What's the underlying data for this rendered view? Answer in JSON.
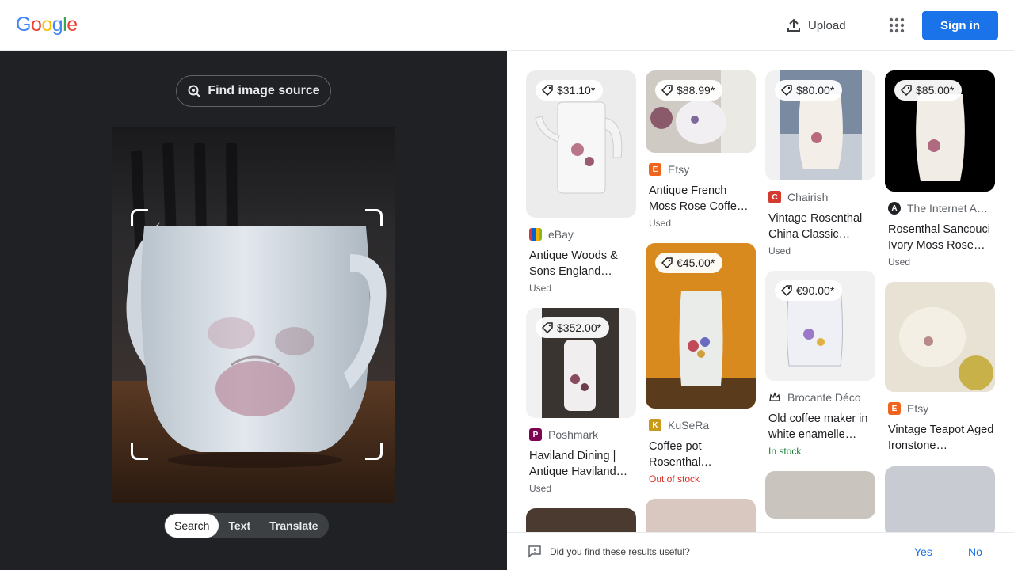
{
  "header": {
    "logo": [
      "G",
      "o",
      "o",
      "g",
      "l",
      "e"
    ],
    "logo_colors": [
      "#4285F4",
      "#EA4335",
      "#FBBC05",
      "#4285F4",
      "#34A853",
      "#EA4335"
    ],
    "upload_label": "Upload",
    "signin_label": "Sign in"
  },
  "left": {
    "find_source_label": "Find image source",
    "modes": [
      "Search",
      "Text",
      "Translate"
    ],
    "active_mode": "Search"
  },
  "results": {
    "col1": [
      {
        "price": "$31.10*",
        "source": "eBay",
        "title": "Antique Woods & Sons England…",
        "status": "Used"
      },
      {
        "price": "$352.00*",
        "source": "Poshmark",
        "title": "Haviland Dining | Antique Haviland…",
        "status": "Used"
      }
    ],
    "col2": [
      {
        "price": "$88.99*",
        "source": "Etsy",
        "title": "Antique French Moss Rose Coffe…",
        "status": "Used"
      },
      {
        "price": "€45.00*",
        "source": "KuSeRa",
        "title": "Coffee pot Rosenthal…",
        "status": "Out of stock"
      }
    ],
    "col3": [
      {
        "price": "$80.00*",
        "source": "Chairish",
        "title": "Vintage Rosenthal China Classic…",
        "status": "Used"
      },
      {
        "price": "€90.00*",
        "source": "Brocante Déco",
        "title": "Old coffee maker in white enamelle…",
        "status": "In stock"
      }
    ],
    "col4": [
      {
        "price": "$85.00*",
        "source": "The Internet A…",
        "title": "Rosenthal Sancouci Ivory Moss Rose…",
        "status": "Used"
      },
      {
        "price": "",
        "source": "Etsy",
        "title": "Vintage Teapot Aged Ironstone…",
        "status": ""
      }
    ]
  },
  "feedback": {
    "question": "Did you find these results useful?",
    "yes_label": "Yes",
    "no_label": "No"
  },
  "colors": {
    "accent": "#1a73e8",
    "dark_panel": "#202124",
    "out_of_stock": "#d93025",
    "in_stock": "#188038"
  }
}
